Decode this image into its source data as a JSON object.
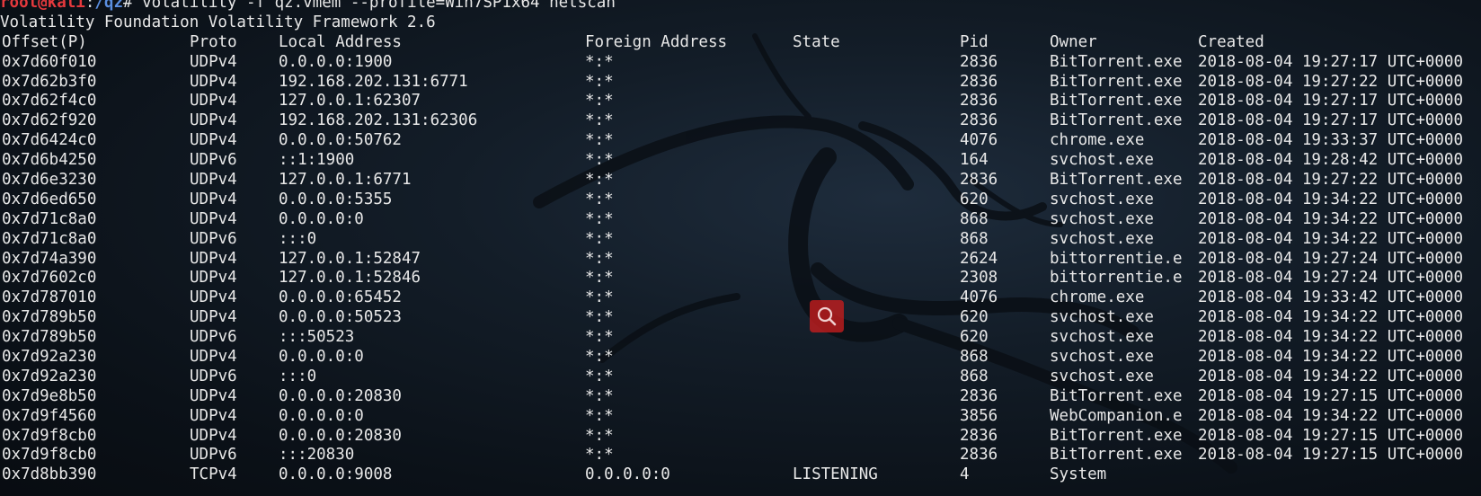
{
  "terminal": {
    "prompt_user": "root@kali",
    "prompt_colon": ":",
    "prompt_path": "/qz",
    "prompt_hash": "# ",
    "command": "volatility -f qz.vmem --profile=Win7SP1x64 netscan",
    "banner": "Volatility Foundation Volatility Framework 2.6"
  },
  "table": {
    "headers": [
      "Offset(P)",
      "Proto",
      "Local Address",
      "Foreign Address",
      "State",
      "Pid",
      "Owner",
      "Created"
    ],
    "rows": [
      [
        "0x7d60f010",
        "UDPv4",
        "0.0.0.0:1900",
        "*:*",
        "",
        "2836",
        "BitTorrent.exe",
        "2018-08-04 19:27:17 UTC+0000"
      ],
      [
        "0x7d62b3f0",
        "UDPv4",
        "192.168.202.131:6771",
        "*:*",
        "",
        "2836",
        "BitTorrent.exe",
        "2018-08-04 19:27:22 UTC+0000"
      ],
      [
        "0x7d62f4c0",
        "UDPv4",
        "127.0.0.1:62307",
        "*:*",
        "",
        "2836",
        "BitTorrent.exe",
        "2018-08-04 19:27:17 UTC+0000"
      ],
      [
        "0x7d62f920",
        "UDPv4",
        "192.168.202.131:62306",
        "*:*",
        "",
        "2836",
        "BitTorrent.exe",
        "2018-08-04 19:27:17 UTC+0000"
      ],
      [
        "0x7d6424c0",
        "UDPv4",
        "0.0.0.0:50762",
        "*:*",
        "",
        "4076",
        "chrome.exe",
        "2018-08-04 19:33:37 UTC+0000"
      ],
      [
        "0x7d6b4250",
        "UDPv6",
        "::1:1900",
        "*:*",
        "",
        "164",
        "svchost.exe",
        "2018-08-04 19:28:42 UTC+0000"
      ],
      [
        "0x7d6e3230",
        "UDPv4",
        "127.0.0.1:6771",
        "*:*",
        "",
        "2836",
        "BitTorrent.exe",
        "2018-08-04 19:27:22 UTC+0000"
      ],
      [
        "0x7d6ed650",
        "UDPv4",
        "0.0.0.0:5355",
        "*:*",
        "",
        "620",
        "svchost.exe",
        "2018-08-04 19:34:22 UTC+0000"
      ],
      [
        "0x7d71c8a0",
        "UDPv4",
        "0.0.0.0:0",
        "*:*",
        "",
        "868",
        "svchost.exe",
        "2018-08-04 19:34:22 UTC+0000"
      ],
      [
        "0x7d71c8a0",
        "UDPv6",
        ":::0",
        "*:*",
        "",
        "868",
        "svchost.exe",
        "2018-08-04 19:34:22 UTC+0000"
      ],
      [
        "0x7d74a390",
        "UDPv4",
        "127.0.0.1:52847",
        "*:*",
        "",
        "2624",
        "bittorrentie.e",
        "2018-08-04 19:27:24 UTC+0000"
      ],
      [
        "0x7d7602c0",
        "UDPv4",
        "127.0.0.1:52846",
        "*:*",
        "",
        "2308",
        "bittorrentie.e",
        "2018-08-04 19:27:24 UTC+0000"
      ],
      [
        "0x7d787010",
        "UDPv4",
        "0.0.0.0:65452",
        "*:*",
        "",
        "4076",
        "chrome.exe",
        "2018-08-04 19:33:42 UTC+0000"
      ],
      [
        "0x7d789b50",
        "UDPv4",
        "0.0.0.0:50523",
        "*:*",
        "",
        "620",
        "svchost.exe",
        "2018-08-04 19:34:22 UTC+0000"
      ],
      [
        "0x7d789b50",
        "UDPv6",
        ":::50523",
        "*:*",
        "",
        "620",
        "svchost.exe",
        "2018-08-04 19:34:22 UTC+0000"
      ],
      [
        "0x7d92a230",
        "UDPv4",
        "0.0.0.0:0",
        "*:*",
        "",
        "868",
        "svchost.exe",
        "2018-08-04 19:34:22 UTC+0000"
      ],
      [
        "0x7d92a230",
        "UDPv6",
        ":::0",
        "*:*",
        "",
        "868",
        "svchost.exe",
        "2018-08-04 19:34:22 UTC+0000"
      ],
      [
        "0x7d9e8b50",
        "UDPv4",
        "0.0.0.0:20830",
        "*:*",
        "",
        "2836",
        "BitTorrent.exe",
        "2018-08-04 19:27:15 UTC+0000"
      ],
      [
        "0x7d9f4560",
        "UDPv4",
        "0.0.0.0:0",
        "*:*",
        "",
        "3856",
        "WebCompanion.e",
        "2018-08-04 19:34:22 UTC+0000"
      ],
      [
        "0x7d9f8cb0",
        "UDPv4",
        "0.0.0.0:20830",
        "*:*",
        "",
        "2836",
        "BitTorrent.exe",
        "2018-08-04 19:27:15 UTC+0000"
      ],
      [
        "0x7d9f8cb0",
        "UDPv6",
        ":::20830",
        "*:*",
        "",
        "2836",
        "BitTorrent.exe",
        "2018-08-04 19:27:15 UTC+0000"
      ],
      [
        "0x7d8bb390",
        "TCPv4",
        "0.0.0.0:9008",
        "0.0.0.0:0",
        "LISTENING",
        "4",
        "System",
        ""
      ]
    ]
  },
  "colors": {
    "prompt_user": "#e5393d",
    "prompt_path": "#5a8ee0",
    "text": "#e8e8e8",
    "background": "#0b1118",
    "search_badge": "#c81e1e"
  },
  "icons": {
    "background": "kali-dragon-watermark",
    "badge": "search-icon"
  }
}
